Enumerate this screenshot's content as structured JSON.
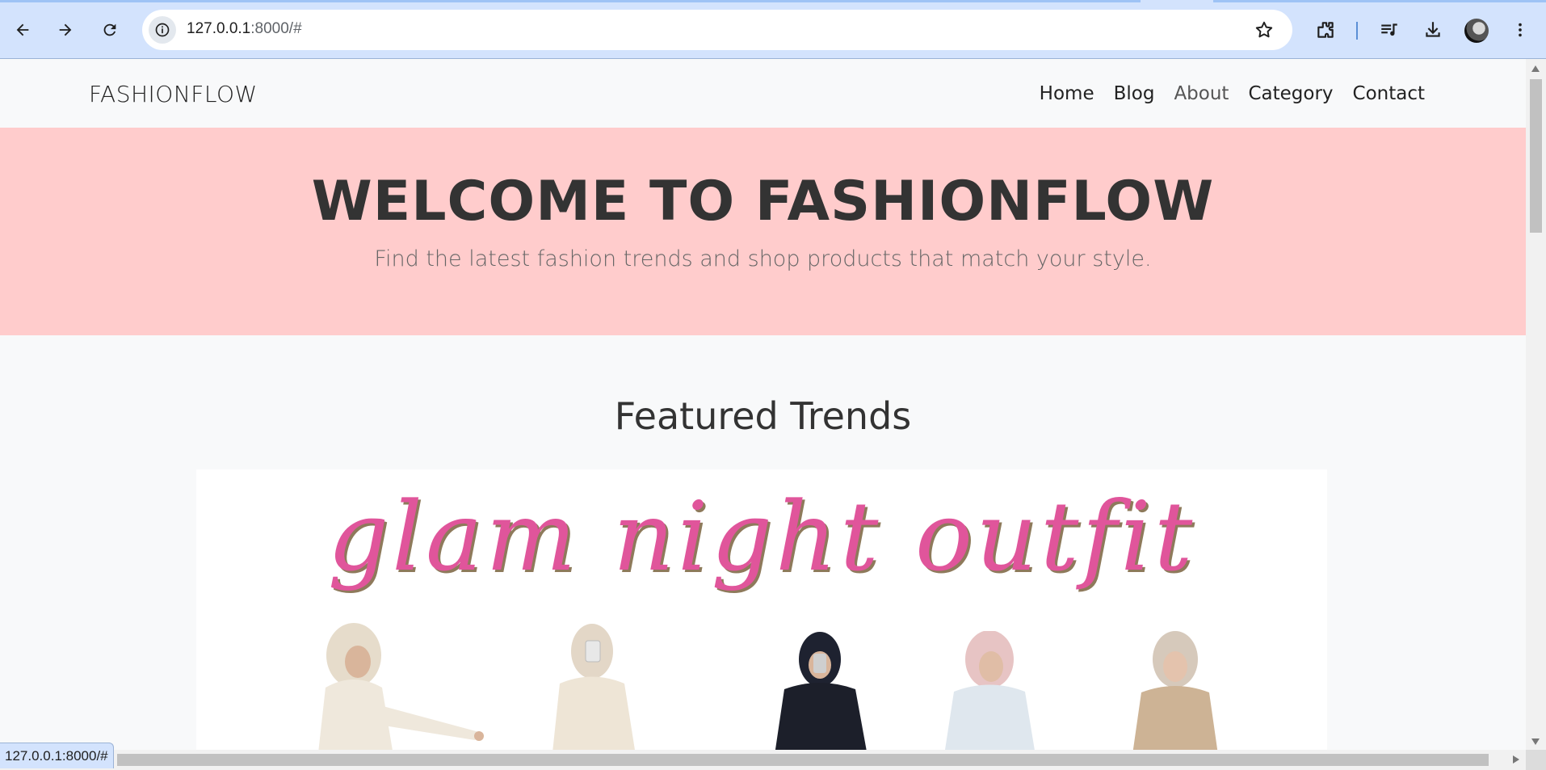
{
  "browser": {
    "url_host": "127.0.0.1",
    "url_rest": ":8000/#",
    "status_url": "127.0.0.1:8000/#"
  },
  "site": {
    "brand": "FASHIONFLOW",
    "nav": [
      "Home",
      "Blog",
      "About",
      "Category",
      "Contact"
    ]
  },
  "hero": {
    "title": "WELCOME TO FASHIONFLOW",
    "subtitle": "Find the latest fashion trends and shop products that match your style."
  },
  "featured": {
    "title": "Featured Trends",
    "banner_text": "glam night outfit"
  },
  "colors": {
    "hero_bg": "#ffcccc",
    "script_pink": "#e0559b",
    "page_bg": "#f8f9fa"
  }
}
